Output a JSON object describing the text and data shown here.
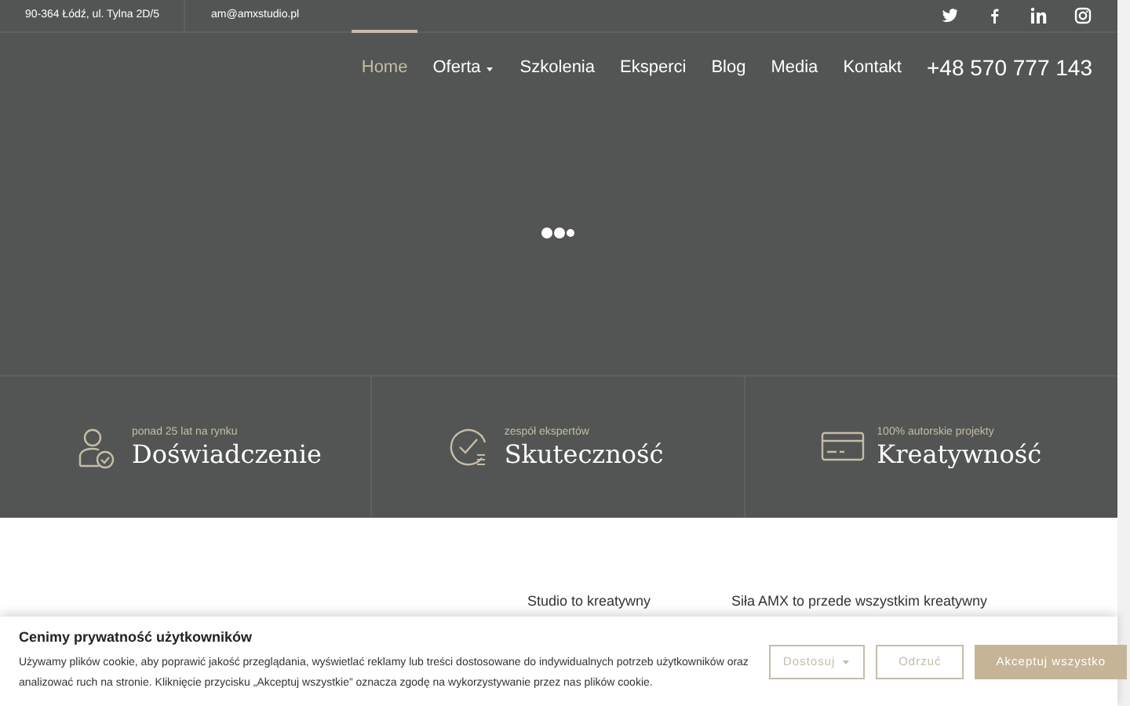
{
  "topbar": {
    "address": "90-364 Łódź, ul. Tylna 2D/5",
    "email": "am@amxstudio.pl",
    "social": [
      {
        "kind": "twitter"
      },
      {
        "kind": "facebook"
      },
      {
        "kind": "linkedin"
      },
      {
        "kind": "instagram"
      }
    ]
  },
  "nav": {
    "items": [
      {
        "label": "Home",
        "selected": true,
        "dropdown": false
      },
      {
        "label": "Oferta",
        "selected": false,
        "dropdown": true
      },
      {
        "label": "Szkolenia",
        "selected": false,
        "dropdown": false
      },
      {
        "label": "Eksperci",
        "selected": false,
        "dropdown": false
      },
      {
        "label": "Blog",
        "selected": false,
        "dropdown": false
      },
      {
        "label": "Media",
        "selected": false,
        "dropdown": false
      },
      {
        "label": "Kontakt",
        "selected": false,
        "dropdown": false
      }
    ],
    "phone": "+48 570 777 143"
  },
  "hero": {
    "loading": true
  },
  "features": [
    {
      "kind": "person",
      "subtitle": "ponad 25 lat na rynku",
      "title": "Doświadczenie"
    },
    {
      "kind": "check",
      "subtitle": "zespół ekspertów",
      "title": "Skuteczność"
    },
    {
      "kind": "card",
      "subtitle": "100% autorskie projekty",
      "title": "Kreatywność"
    }
  ],
  "intro": {
    "column_2": "Studio to kreatywny",
    "column_3": "Siła AMX to przede wszystkim kreatywny"
  },
  "cookie_banner": {
    "title": "Cenimy prywatność użytkowników",
    "text": "Używamy plików cookie, aby poprawić jakość przeglądania, wyświetlać reklamy lub treści dostosowane do indywidualnych potrzeb użytkowników oraz analizować ruch na stronie. Kliknięcie przycisku „Akceptuj wszystkie” oznacza zgodę na wykorzystywanie przez nas plików cookie.",
    "buttons": [
      {
        "kind": "dropdown",
        "label": "Dostosuj"
      },
      {
        "kind": "outline",
        "label": "Odrzuć"
      },
      {
        "kind": "primary",
        "label": "Akceptuj wszystko"
      }
    ]
  }
}
